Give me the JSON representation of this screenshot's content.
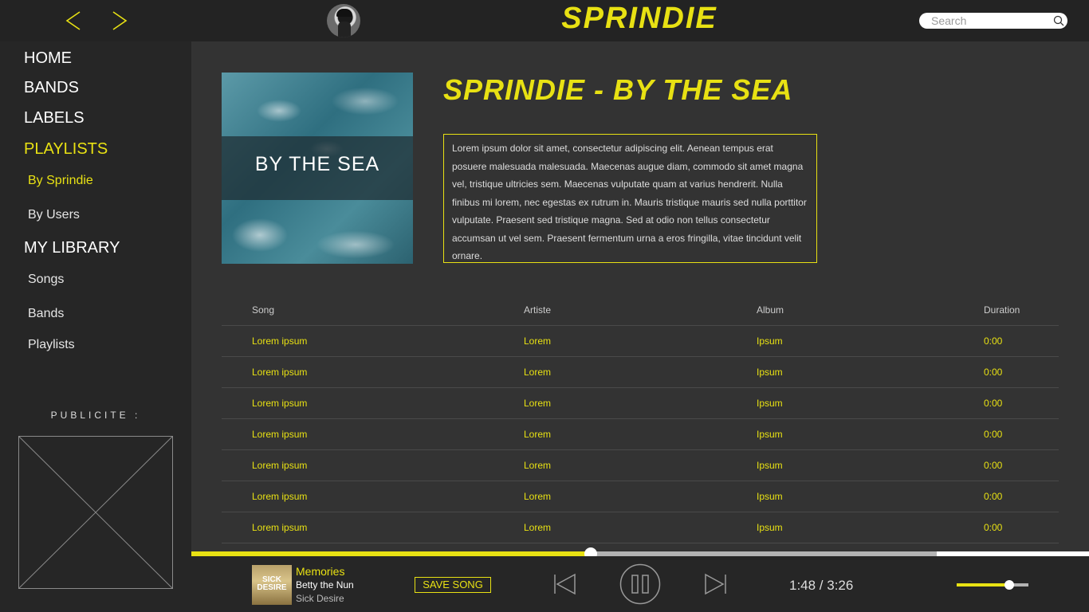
{
  "app": {
    "logo": "SPRINDIE"
  },
  "search": {
    "placeholder": "Search"
  },
  "sidebar": {
    "items": [
      {
        "label": "HOME"
      },
      {
        "label": "BANDS"
      },
      {
        "label": "LABELS"
      },
      {
        "label": "PLAYLISTS"
      },
      {
        "label": "By Sprindie"
      },
      {
        "label": "By Users"
      },
      {
        "label": "MY LIBRARY"
      },
      {
        "label": "Songs"
      },
      {
        "label": "Bands"
      },
      {
        "label": "Playlists"
      }
    ],
    "ad_label": "PUBLICITE :"
  },
  "playlist": {
    "cover_text": "BY THE SEA",
    "title": "SPRINDIE - BY THE SEA",
    "description": "Lorem ipsum dolor sit amet, consectetur adipiscing elit. Aenean tempus erat posuere malesuada malesuada. Maecenas augue diam, commodo sit amet magna vel, tristique ultricies sem. Maecenas vulputate quam at varius hendrerit. Nulla finibus mi lorem, nec egestas ex rutrum in. Mauris tristique mauris sed nulla porttitor vulputate. Praesent sed tristique magna. Sed at odio non tellus consectetur accumsan ut vel sem. Praesent fermentum urna a eros fringilla, vitae tincidunt velit ornare."
  },
  "table": {
    "headers": {
      "song": "Song",
      "artist": "Artiste",
      "album": "Album",
      "duration": "Duration"
    },
    "rows": [
      {
        "song": "Lorem ipsum",
        "artist": "Lorem",
        "album": "Ipsum",
        "duration": "0:00"
      },
      {
        "song": "Lorem ipsum",
        "artist": "Lorem",
        "album": "Ipsum",
        "duration": "0:00"
      },
      {
        "song": "Lorem ipsum",
        "artist": "Lorem",
        "album": "Ipsum",
        "duration": "0:00"
      },
      {
        "song": "Lorem ipsum",
        "artist": "Lorem",
        "album": "Ipsum",
        "duration": "0:00"
      },
      {
        "song": "Lorem ipsum",
        "artist": "Lorem",
        "album": "Ipsum",
        "duration": "0:00"
      },
      {
        "song": "Lorem ipsum",
        "artist": "Lorem",
        "album": "Ipsum",
        "duration": "0:00"
      },
      {
        "song": "Lorem ipsum",
        "artist": "Lorem",
        "album": "Ipsum",
        "duration": "0:00"
      }
    ]
  },
  "player": {
    "thumb_text": "SICK DESIRE",
    "title": "Memories",
    "artist": "Betty the Nun",
    "album": "Sick Desire",
    "save_label": "SAVE SONG",
    "time": "1:48 / 3:26",
    "progress": 0.445,
    "buffered": 0.83,
    "volume": 0.73
  },
  "colors": {
    "accent": "#e8e113",
    "background": "#333333",
    "sidebar": "#262626",
    "topbar": "#232323"
  },
  "icons": [
    "back-arrow-icon",
    "forward-arrow-icon",
    "search-icon",
    "skip-previous-icon",
    "pause-icon",
    "skip-next-icon"
  ]
}
